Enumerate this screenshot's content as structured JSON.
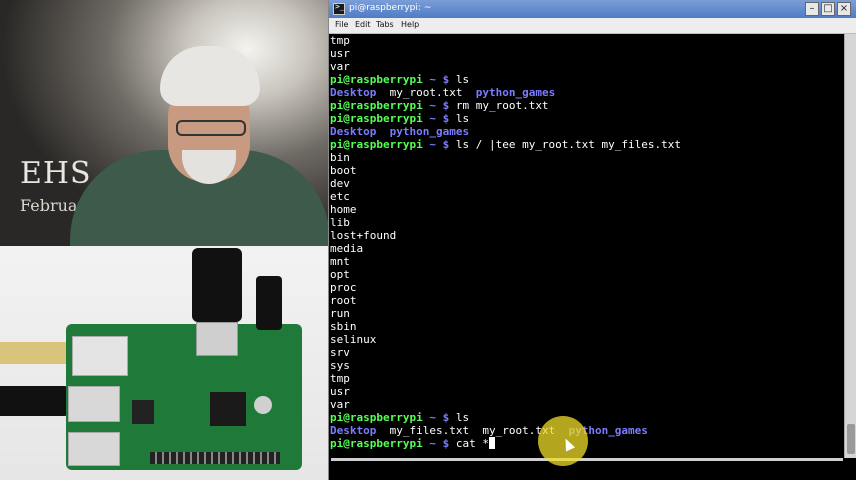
{
  "webcam": {
    "poster_text": "EHS",
    "poster_sub": "Februar"
  },
  "window": {
    "title": "pi@raspberrypi: ~",
    "min_glyph": "–",
    "max_glyph": "□",
    "close_glyph": "×"
  },
  "menu": {
    "file": "File",
    "edit": "Edit",
    "tabs": "Tabs",
    "help": "Help"
  },
  "prompt": {
    "user": "pi@raspberrypi",
    "path": "~",
    "symbol": "$"
  },
  "terminal_lines": [
    {
      "kind": "text",
      "text": "tmp"
    },
    {
      "kind": "text",
      "text": "usr"
    },
    {
      "kind": "text",
      "text": "var"
    },
    {
      "kind": "prompt",
      "cmd": "ls"
    },
    {
      "kind": "listing",
      "items": [
        {
          "text": "Desktop",
          "dir": true,
          "pad": "  "
        },
        {
          "text": "my_root.txt",
          "dir": false,
          "pad": "  "
        },
        {
          "text": "python_games",
          "dir": true,
          "pad": ""
        }
      ]
    },
    {
      "kind": "prompt",
      "cmd": "rm my_root.txt"
    },
    {
      "kind": "prompt",
      "cmd": "ls"
    },
    {
      "kind": "listing",
      "items": [
        {
          "text": "Desktop",
          "dir": true,
          "pad": "  "
        },
        {
          "text": "python_games",
          "dir": true,
          "pad": ""
        }
      ]
    },
    {
      "kind": "prompt",
      "cmd": "ls / |tee my_root.txt my_files.txt"
    },
    {
      "kind": "text",
      "text": "bin"
    },
    {
      "kind": "text",
      "text": "boot"
    },
    {
      "kind": "text",
      "text": "dev"
    },
    {
      "kind": "text",
      "text": "etc"
    },
    {
      "kind": "text",
      "text": "home"
    },
    {
      "kind": "text",
      "text": "lib"
    },
    {
      "kind": "text",
      "text": "lost+found"
    },
    {
      "kind": "text",
      "text": "media"
    },
    {
      "kind": "text",
      "text": "mnt"
    },
    {
      "kind": "text",
      "text": "opt"
    },
    {
      "kind": "text",
      "text": "proc"
    },
    {
      "kind": "text",
      "text": "root"
    },
    {
      "kind": "text",
      "text": "run"
    },
    {
      "kind": "text",
      "text": "sbin"
    },
    {
      "kind": "text",
      "text": "selinux"
    },
    {
      "kind": "text",
      "text": "srv"
    },
    {
      "kind": "text",
      "text": "sys"
    },
    {
      "kind": "text",
      "text": "tmp"
    },
    {
      "kind": "text",
      "text": "usr"
    },
    {
      "kind": "text",
      "text": "var"
    },
    {
      "kind": "prompt",
      "cmd": "ls"
    },
    {
      "kind": "listing",
      "items": [
        {
          "text": "Desktop",
          "dir": true,
          "pad": "  "
        },
        {
          "text": "my_files.txt",
          "dir": false,
          "pad": "  "
        },
        {
          "text": "my_root.txt",
          "dir": false,
          "pad": "  "
        },
        {
          "text": "python_games",
          "dir": true,
          "pad": ""
        }
      ]
    },
    {
      "kind": "prompt",
      "cmd": "cat *",
      "cursor": true
    }
  ],
  "colors": {
    "prompt_user": "#55ff55",
    "prompt_path": "#7b7bff",
    "directory": "#7b7bff",
    "text": "#ffffff",
    "titlebar": "#4e7cc6",
    "highlight": "#f0dc28"
  }
}
